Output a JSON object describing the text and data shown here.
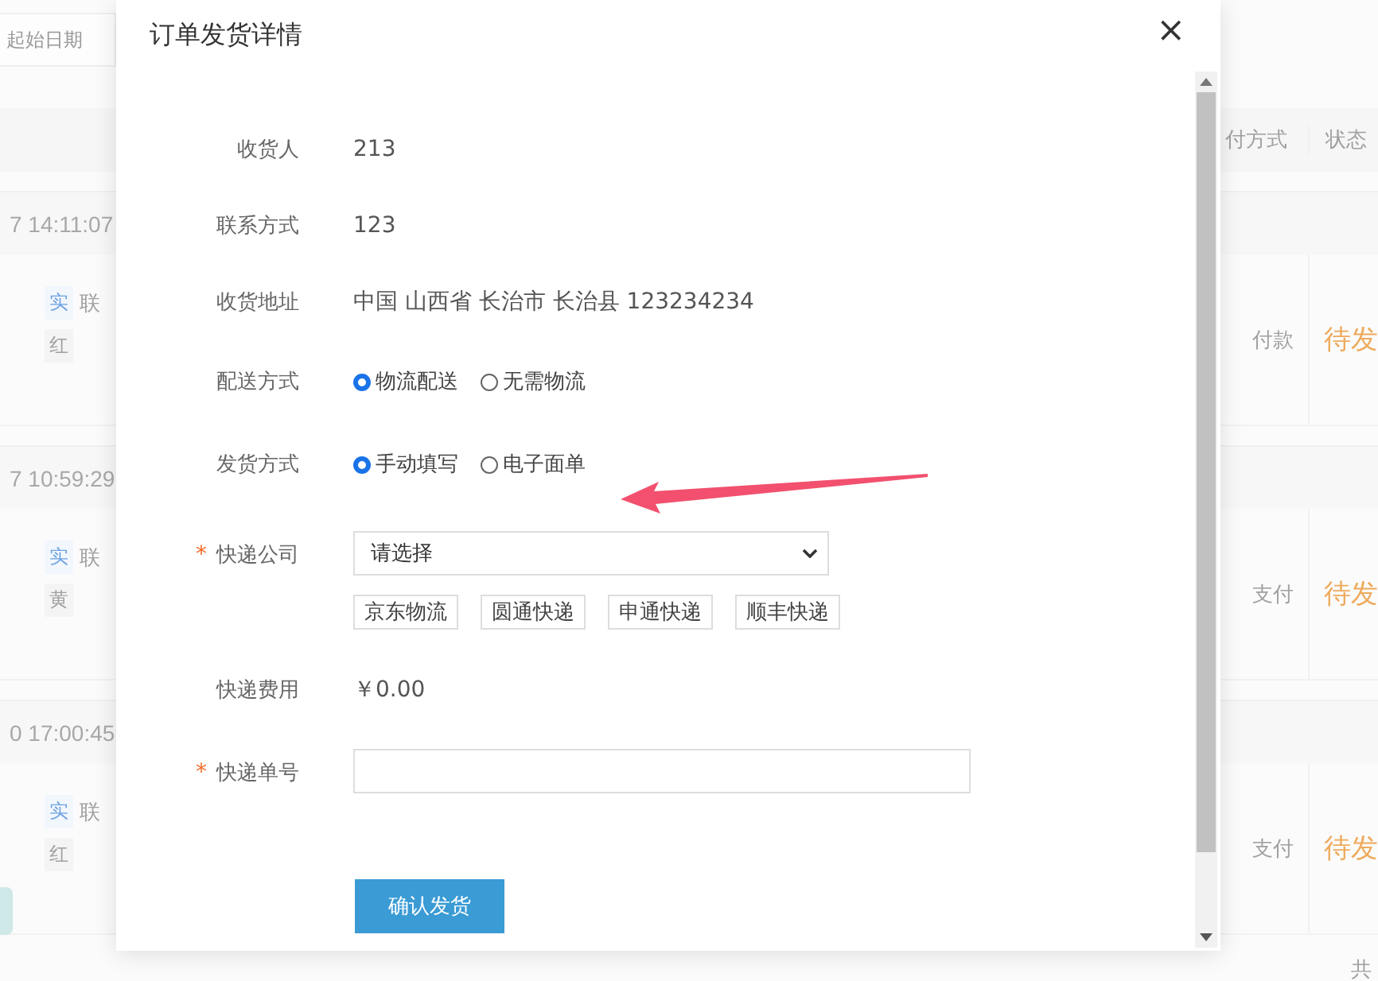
{
  "background": {
    "date_field": {
      "placeholder": "起始日期"
    },
    "columns": [
      "付方式",
      "状态"
    ],
    "orders": [
      {
        "time": "7 14:11:07",
        "type_tag": "实",
        "product": "联",
        "color_tag": "红",
        "payment": "付款",
        "status": "待发",
        "photo": false
      },
      {
        "time": "7 10:59:29",
        "type_tag": "实",
        "product": "联",
        "color_tag": "黄",
        "payment": "支付",
        "status": "待发",
        "photo": false
      },
      {
        "time": "0 17:00:45",
        "type_tag": "实",
        "product": "联",
        "color_tag": "红",
        "payment": "支付",
        "status": "待发",
        "photo": true
      }
    ],
    "footer": "共"
  },
  "dialog": {
    "title": "订单发货详情",
    "close": "×",
    "fields": [
      {
        "kind": "text",
        "label": "收货人",
        "value": "213"
      },
      {
        "kind": "text",
        "label": "联系方式",
        "value": "123"
      },
      {
        "kind": "text",
        "label": "收货地址",
        "value": "中国 山西省 长治市 长治县 123234234"
      },
      {
        "kind": "radio",
        "label": "配送方式",
        "options": [
          {
            "label": "物流配送",
            "selected": true
          },
          {
            "label": "无需物流",
            "selected": false
          }
        ]
      },
      {
        "kind": "radio",
        "label": "发货方式",
        "options": [
          {
            "label": "手动填写",
            "selected": true
          },
          {
            "label": "电子面单",
            "selected": false
          }
        ]
      },
      {
        "kind": "select",
        "label": "快递公司",
        "required_mark": "*",
        "value": "请选择",
        "chips": [
          "京东物流",
          "圆通快递",
          "申通快递",
          "顺丰快递"
        ]
      },
      {
        "kind": "text",
        "label": "快递费用",
        "value": "￥0.00"
      },
      {
        "kind": "input",
        "label": "快递单号",
        "required_mark": "*"
      }
    ],
    "submit": "确认发货"
  }
}
